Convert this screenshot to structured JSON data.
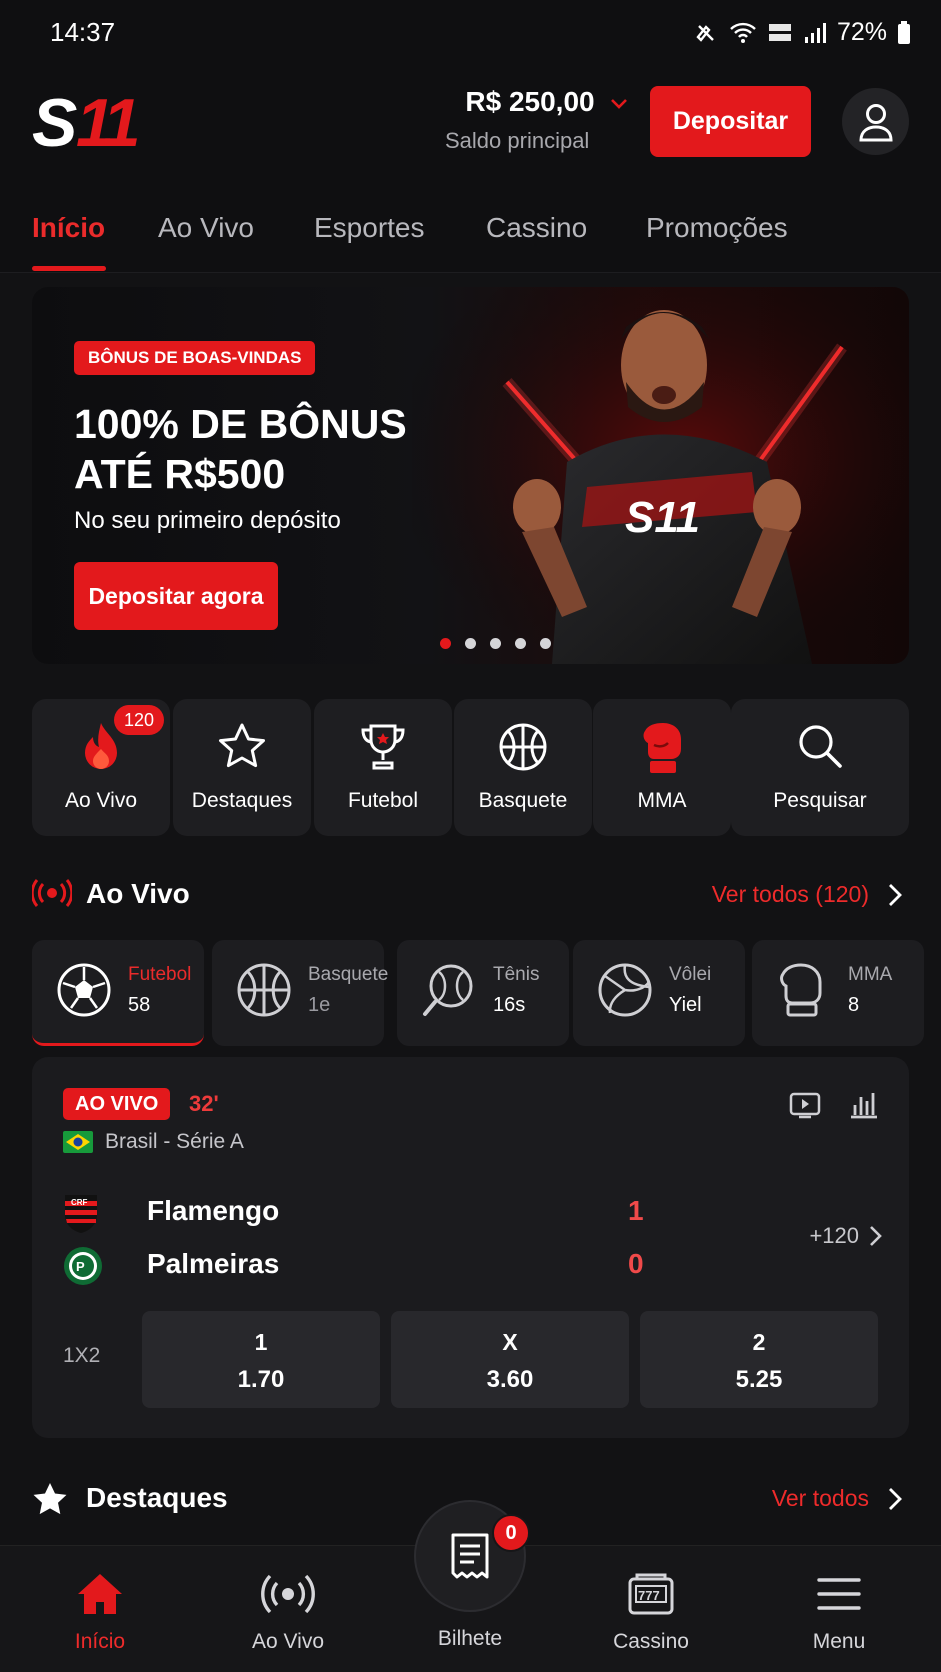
{
  "status_bar": {
    "time": "14:37",
    "battery": "72%"
  },
  "header": {
    "balance_amount": "R$ 250,00",
    "balance_label": "Saldo principal",
    "deposit_label": "Depositar"
  },
  "tabs": [
    "Início",
    "Ao Vivo",
    "Esportes",
    "Cassino",
    "Promoções"
  ],
  "banner": {
    "badge": "BÔNUS DE BOAS-VINDAS",
    "title_line1": "100% DE BÔNUS",
    "title_line2": "ATÉ R$500",
    "subtitle": "No seu primeiro depósito",
    "cta": "Depositar agora",
    "shirt_logo": "S11"
  },
  "quick_menu": [
    {
      "label": "Ao Vivo",
      "icon": "flame-icon",
      "badge": "120"
    },
    {
      "label": "Destaques",
      "icon": "star-icon"
    },
    {
      "label": "Futebol",
      "icon": "trophy-icon"
    },
    {
      "label": "Basquete",
      "icon": "basketball-icon"
    },
    {
      "label": "MMA",
      "icon": "boxing-glove-icon"
    },
    {
      "label": "Pesquisar",
      "icon": "search-icon"
    }
  ],
  "live_section": {
    "title": "Ao Vivo",
    "link": "Ver todos (120)"
  },
  "sports": [
    {
      "name": "Futebol",
      "count": "58"
    },
    {
      "name": "Basquete",
      "count": "1e"
    },
    {
      "name": "Tênis",
      "count": "16s"
    },
    {
      "name": "Vôlei",
      "count": "Yiel"
    },
    {
      "name": "MMA",
      "count": "8"
    }
  ],
  "match": {
    "live_label": "AO VIVO",
    "minute": "32'",
    "league": "Brasil - Série A",
    "home_team": "Flamengo",
    "home_score": "1",
    "away_team": "Palmeiras",
    "away_score": "0",
    "more_markets": "+120",
    "market_label": "1X2",
    "odds": [
      {
        "name": "1",
        "value": "1.70"
      },
      {
        "name": "X",
        "value": "3.60"
      },
      {
        "name": "2",
        "value": "5.25"
      }
    ]
  },
  "highlights_section": {
    "title": "Destaques",
    "link": "Ver todos"
  },
  "bottom_nav": {
    "items": [
      "Início",
      "Ao Vivo",
      "Cassino",
      "Menu"
    ],
    "ticket_label": "Bilhete",
    "ticket_count": "0"
  },
  "colors": {
    "accent": "#e3191c",
    "background": "#121214",
    "card": "#1b1b1e"
  }
}
